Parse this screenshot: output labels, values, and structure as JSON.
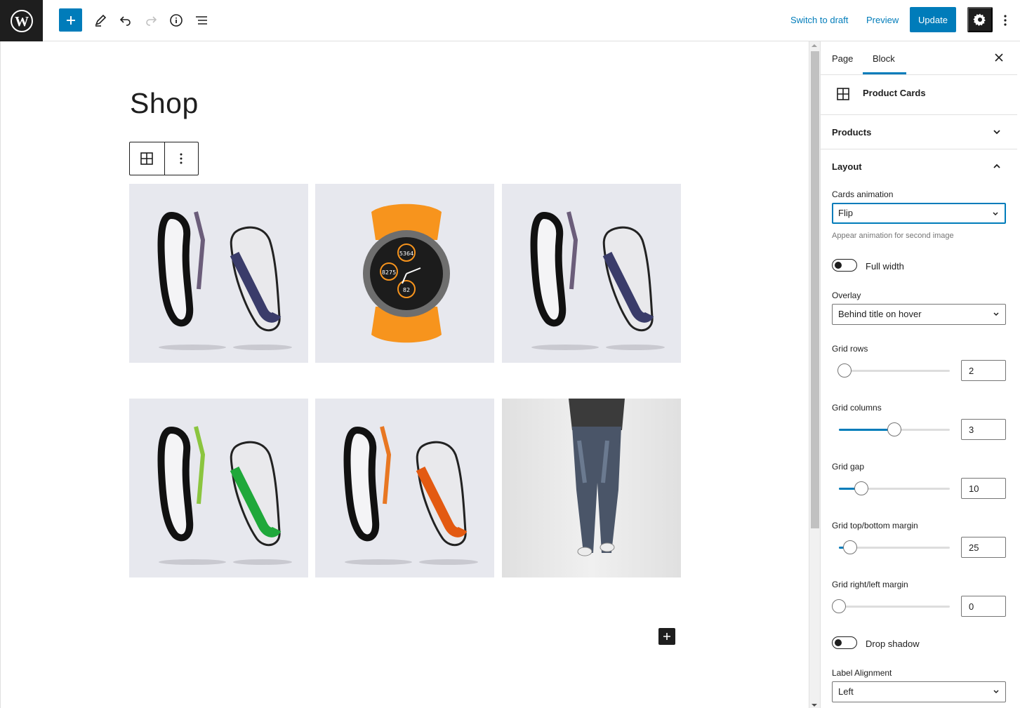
{
  "topbar": {
    "switch_to_draft": "Switch to draft",
    "preview": "Preview",
    "update": "Update"
  },
  "editor": {
    "page_title": "Shop",
    "cards": [
      {
        "name": "product-card-sneakers-purple"
      },
      {
        "name": "product-card-watch-orange"
      },
      {
        "name": "product-card-sneakers-purple-2"
      },
      {
        "name": "product-card-sneakers-green"
      },
      {
        "name": "product-card-sneakers-orange"
      },
      {
        "name": "product-card-jeans"
      }
    ]
  },
  "sidebar": {
    "tabs": {
      "page": "Page",
      "block": "Block"
    },
    "block_title": "Product Cards",
    "panels": {
      "products": "Products",
      "layout": "Layout"
    },
    "layout": {
      "cards_animation_label": "Cards animation",
      "cards_animation_value": "Flip",
      "cards_animation_help": "Appear animation for second image",
      "full_width_label": "Full width",
      "overlay_label": "Overlay",
      "overlay_value": "Behind title on hover",
      "grid_rows_label": "Grid rows",
      "grid_rows_value": "2",
      "grid_columns_label": "Grid columns",
      "grid_columns_value": "3",
      "grid_gap_label": "Grid gap",
      "grid_gap_value": "10",
      "grid_tb_margin_label": "Grid top/bottom margin",
      "grid_tb_margin_value": "25",
      "grid_rl_margin_label": "Grid right/left margin",
      "grid_rl_margin_value": "0",
      "drop_shadow_label": "Drop shadow",
      "label_alignment_label": "Label Alignment",
      "label_alignment_value": "Left"
    },
    "slider_levels": {
      "grid_rows": 0.05,
      "grid_columns": 0.5,
      "grid_gap": 0.2,
      "grid_tb_margin": 0.1,
      "grid_rl_margin": 0.0
    }
  },
  "colors": {
    "accent": "#007cba",
    "dark": "#1e1e1e",
    "watch_strap": "#f7941d"
  }
}
